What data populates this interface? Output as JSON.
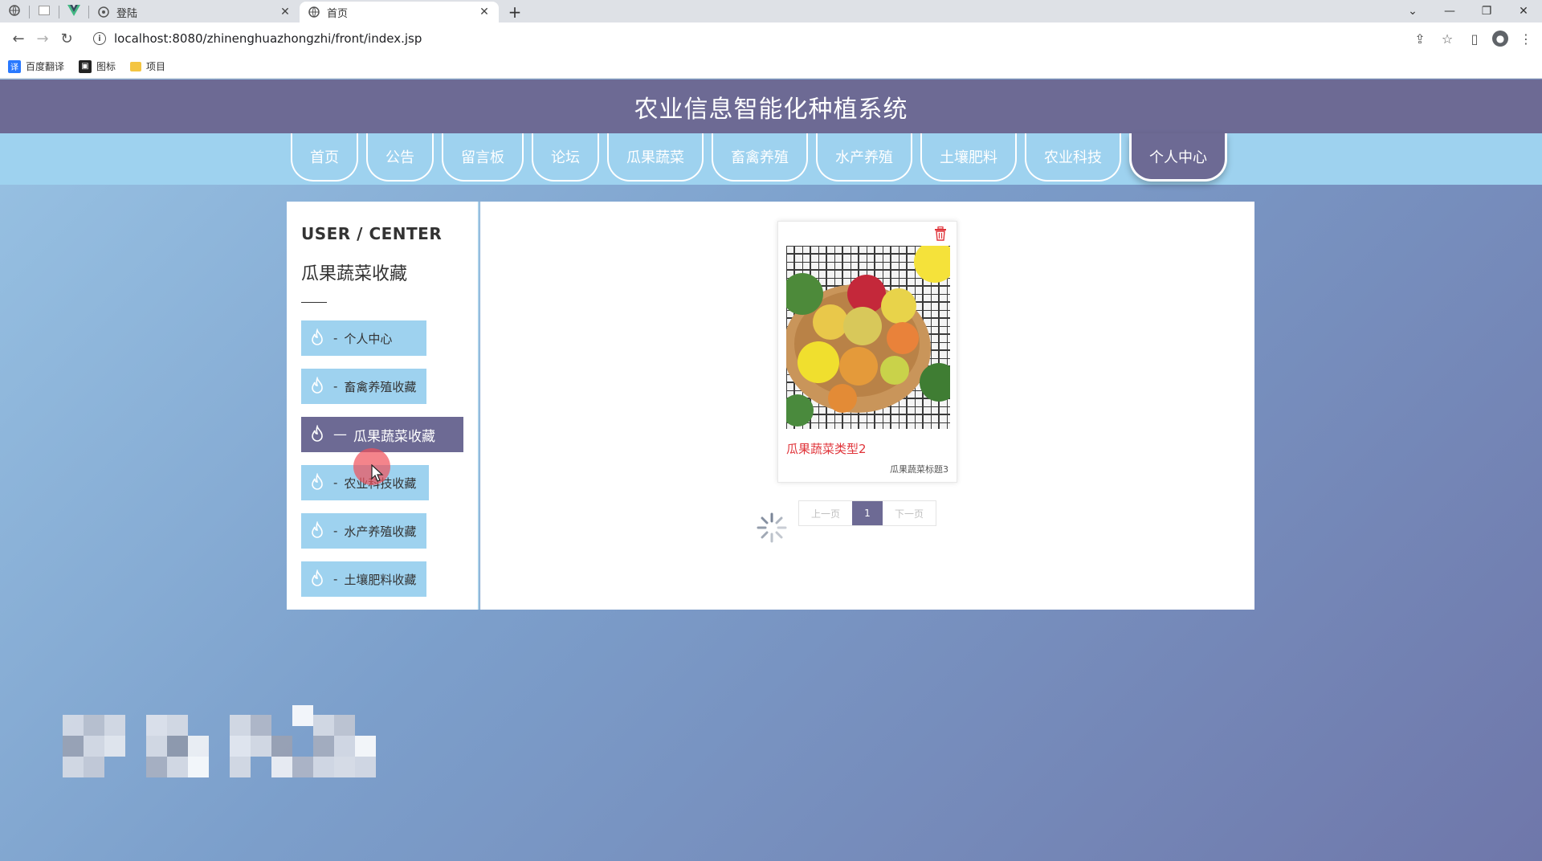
{
  "browser": {
    "tabs": [
      {
        "title": "登陆",
        "active": false
      },
      {
        "title": "首页",
        "active": true
      }
    ],
    "url": "localhost:8080/zhinenghuazhongzhi/front/index.jsp",
    "bookmarks": [
      {
        "label": "百度翻译",
        "icon": "translate-icon"
      },
      {
        "label": "图标",
        "icon": "image-icon"
      },
      {
        "label": "项目",
        "icon": "folder-icon"
      }
    ]
  },
  "site": {
    "title": "农业信息智能化种植系统",
    "nav": [
      "首页",
      "公告",
      "留言板",
      "论坛",
      "瓜果蔬菜",
      "畜禽养殖",
      "水产养殖",
      "土壤肥料",
      "农业科技",
      "个人中心"
    ],
    "active_nav": "个人中心"
  },
  "sidebar": {
    "title": "USER / CENTER",
    "subtitle": "瓜果蔬菜收藏",
    "items": [
      {
        "label": "个人中心",
        "active": false
      },
      {
        "label": "畜禽养殖收藏",
        "active": false
      },
      {
        "label": "瓜果蔬菜收藏",
        "active": true
      },
      {
        "label": "农业科技收藏",
        "active": false
      },
      {
        "label": "水产养殖收藏",
        "active": false
      },
      {
        "label": "土壤肥料收藏",
        "active": false
      }
    ]
  },
  "card": {
    "category": "瓜果蔬菜类型2",
    "title": "瓜果蔬菜标题3"
  },
  "pager": {
    "prev": "上一页",
    "current": "1",
    "next": "下一页"
  },
  "colors": {
    "header": "#6d6a94",
    "nav": "#9ed2ef",
    "accent_red": "#e0343a"
  }
}
